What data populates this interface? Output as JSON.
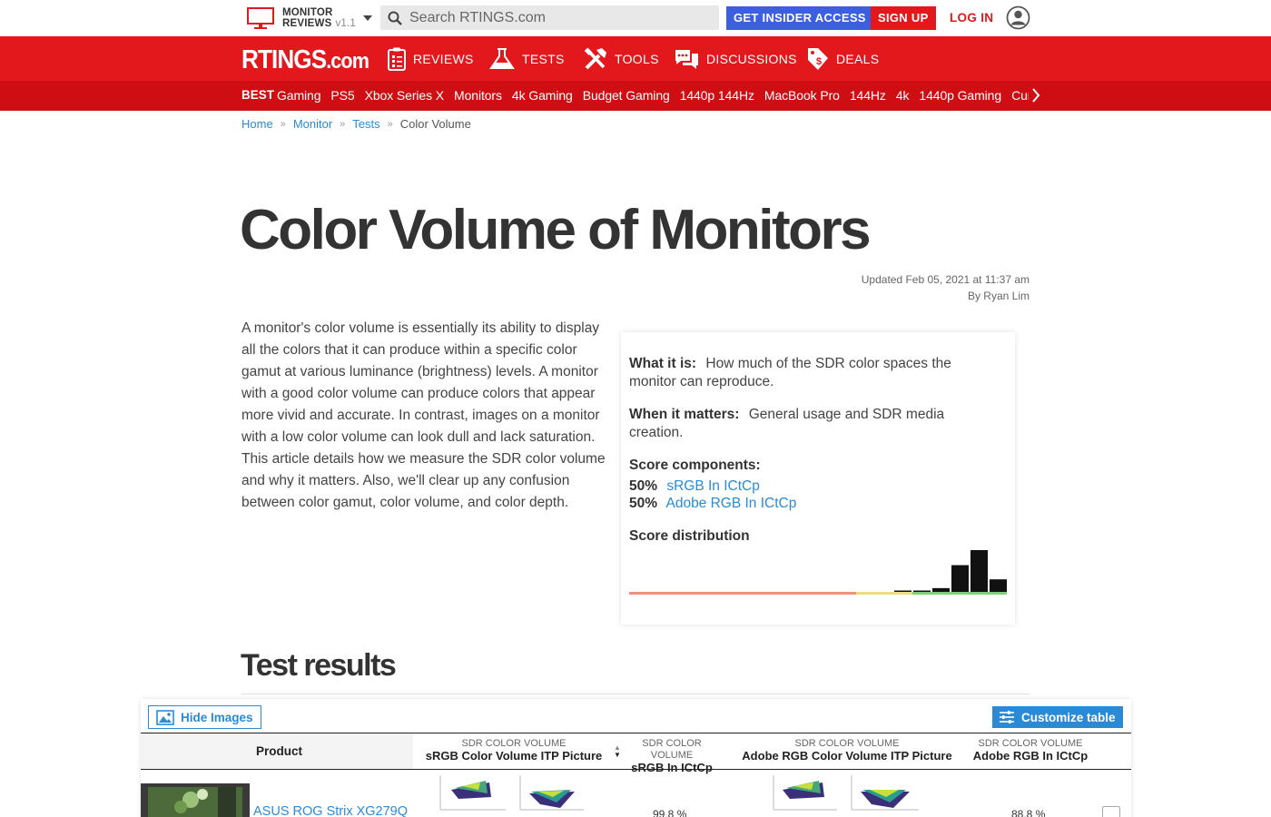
{
  "topbar": {
    "product_line1": "MONITOR",
    "product_line2": "REVIEWS",
    "product_version": "v1.1",
    "search_placeholder": "Search RTINGS.com",
    "insider_label": "GET INSIDER ACCESS",
    "signup_label": "SIGN UP",
    "login_label": "LOG IN"
  },
  "nav": {
    "logo_main": "RTINGS",
    "logo_suffix": ".com",
    "items": [
      "REVIEWS",
      "TESTS",
      "TOOLS",
      "DISCUSSIONS",
      "DEALS"
    ]
  },
  "best": {
    "label": "BEST",
    "items": [
      "Gaming",
      "PS5",
      "Xbox Series X",
      "Monitors",
      "4k Gaming",
      "Budget Gaming",
      "1440p 144Hz",
      "MacBook Pro",
      "144Hz",
      "4k",
      "1440p Gaming",
      "Curved"
    ]
  },
  "breadcrumb": [
    "Home",
    "Monitor",
    "Tests",
    "Color Volume"
  ],
  "page": {
    "title": "Color Volume of Monitors",
    "updated": "Updated Feb 05, 2021 at 11:37 am",
    "author": "By Ryan Lim",
    "intro": "A monitor's color volume is essentially its ability to display all the colors that it can produce within a specific color gamut at various luminance (brightness) levels. A monitor with a good color volume can produce colors that appear more vivid and accurate. In contrast, images on a monitor with a low color volume can look dull and lack saturation. This article details how we measure the SDR color volume and why it matters. Also, we'll clear up any confusion between color gamut, color volume, and color depth."
  },
  "info": {
    "what_label": "What it is:",
    "what_text": "How much of the SDR color spaces the monitor can reproduce.",
    "when_label": "When it matters:",
    "when_text": "General usage and SDR media creation.",
    "components_label": "Score components:",
    "components": [
      {
        "weight": "50%",
        "name": "sRGB In ICtCp"
      },
      {
        "weight": "50%",
        "name": "Adobe RGB In ICtCp"
      }
    ],
    "distribution_label": "Score distribution",
    "distribution_bars": [
      0.02,
      0.03,
      0.09,
      0.64,
      1.0,
      0.3
    ],
    "colors": {
      "bad": "#f09080",
      "mid": "#ebdf7e",
      "good": "#7fcf7a"
    }
  },
  "results": {
    "title": "Test results",
    "hide_images": "Hide Images",
    "customize": "Customize table",
    "columns": {
      "product": "Product",
      "group": "SDR COLOR VOLUME",
      "col1": "sRGB Color Volume ITP Picture",
      "col2": "sRGB In ICtCp",
      "col3": "Adobe RGB Color Volume ITP Picture",
      "col4": "Adobe RGB In ICtCp"
    },
    "rows": [
      {
        "name": "ASUS ROG Strix XG279Q",
        "srgb": "99.8 %",
        "adobe": "88.8 %"
      }
    ]
  }
}
